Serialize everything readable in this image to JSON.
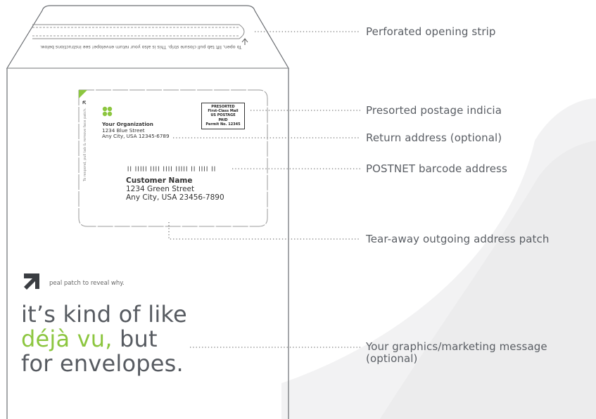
{
  "flap": {
    "instruction": "To open, lift tab pull closure strip. This is also your return envelope! see instructions below."
  },
  "patch": {
    "side_text": "To respond, pull tab & remove face patch.",
    "indicia": [
      "PRESORTED",
      "First-Class Mail",
      "US POSTAGE",
      "PAID",
      "Permit No. 12345"
    ],
    "return_address": {
      "name": "Your Organization",
      "street": "1234 Blue Street",
      "city": "Any City, USA 12345-6789"
    },
    "barcode": "|| ||||| |||| |||| ||||| || |||| ||",
    "customer": {
      "name": "Customer Name",
      "street": "1234 Green Street",
      "city": "Any City, USA 23456-7890"
    }
  },
  "marketing": {
    "peal_text": "peal patch to reveal why.",
    "line1": "it’s kind of like",
    "line2_green": "déjà vu,",
    "line2_rest": "but",
    "line3": "for envelopes."
  },
  "callouts": {
    "perforated": "Perforated opening strip",
    "indicia": "Presorted postage indicia",
    "return": "Return address (optional)",
    "postnet": "POSTNET barcode address",
    "tear": "Tear-away outgoing address patch",
    "graphics_line1": "Your graphics/marketing message",
    "graphics_line2": "(optional)"
  },
  "colors": {
    "accent_green": "#8cc63f",
    "background_swirl": "#f3f3f4",
    "envelope_outline": "#6a6d72",
    "text_gray": "#575b61"
  }
}
